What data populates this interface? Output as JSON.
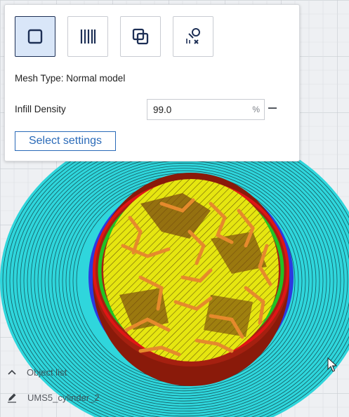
{
  "panel": {
    "mode_buttons": [
      {
        "name": "mesh-normal-model-button",
        "icon": "square-icon",
        "active": true
      },
      {
        "name": "mesh-infill-only-button",
        "icon": "vertical-lines-icon",
        "active": false
      },
      {
        "name": "mesh-overlap-button",
        "icon": "overlap-squares-icon",
        "active": false
      },
      {
        "name": "mesh-support-blocker-button",
        "icon": "support-blocker-icon",
        "active": false
      }
    ],
    "mesh_type_label": "Mesh Type: Normal model",
    "infill_label": "Infill Density",
    "infill_value": "99.0",
    "infill_unit": "%",
    "select_settings_label": "Select settings"
  },
  "object_list": {
    "label": "Object list",
    "object_name": "UMS5_cylinder_2"
  },
  "colors": {
    "accent": "#2a6ab8",
    "active_button_bg": "#d9e6f8",
    "skirt": "#2fd6dc",
    "wall_outer": "#e01515",
    "wall_inner": "#22c322",
    "infill": "#e6e610",
    "support": "#e58a2c",
    "shell": "#8a1a0a"
  }
}
